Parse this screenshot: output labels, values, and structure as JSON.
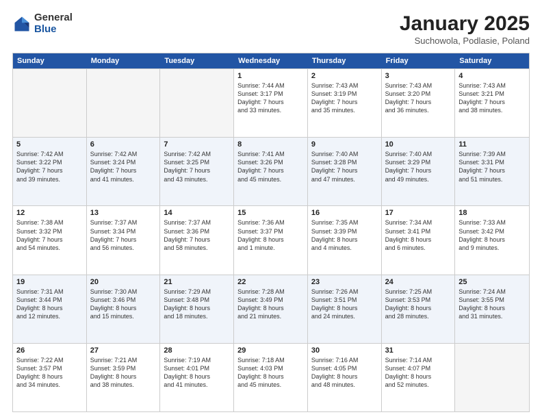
{
  "logo": {
    "general": "General",
    "blue": "Blue"
  },
  "title": "January 2025",
  "subtitle": "Suchowola, Podlasie, Poland",
  "header_days": [
    "Sunday",
    "Monday",
    "Tuesday",
    "Wednesday",
    "Thursday",
    "Friday",
    "Saturday"
  ],
  "rows": [
    [
      {
        "day": "",
        "info": "",
        "empty": true
      },
      {
        "day": "",
        "info": "",
        "empty": true
      },
      {
        "day": "",
        "info": "",
        "empty": true
      },
      {
        "day": "1",
        "info": "Sunrise: 7:44 AM\nSunset: 3:17 PM\nDaylight: 7 hours\nand 33 minutes."
      },
      {
        "day": "2",
        "info": "Sunrise: 7:43 AM\nSunset: 3:19 PM\nDaylight: 7 hours\nand 35 minutes."
      },
      {
        "day": "3",
        "info": "Sunrise: 7:43 AM\nSunset: 3:20 PM\nDaylight: 7 hours\nand 36 minutes."
      },
      {
        "day": "4",
        "info": "Sunrise: 7:43 AM\nSunset: 3:21 PM\nDaylight: 7 hours\nand 38 minutes."
      }
    ],
    [
      {
        "day": "5",
        "info": "Sunrise: 7:42 AM\nSunset: 3:22 PM\nDaylight: 7 hours\nand 39 minutes."
      },
      {
        "day": "6",
        "info": "Sunrise: 7:42 AM\nSunset: 3:24 PM\nDaylight: 7 hours\nand 41 minutes."
      },
      {
        "day": "7",
        "info": "Sunrise: 7:42 AM\nSunset: 3:25 PM\nDaylight: 7 hours\nand 43 minutes."
      },
      {
        "day": "8",
        "info": "Sunrise: 7:41 AM\nSunset: 3:26 PM\nDaylight: 7 hours\nand 45 minutes."
      },
      {
        "day": "9",
        "info": "Sunrise: 7:40 AM\nSunset: 3:28 PM\nDaylight: 7 hours\nand 47 minutes."
      },
      {
        "day": "10",
        "info": "Sunrise: 7:40 AM\nSunset: 3:29 PM\nDaylight: 7 hours\nand 49 minutes."
      },
      {
        "day": "11",
        "info": "Sunrise: 7:39 AM\nSunset: 3:31 PM\nDaylight: 7 hours\nand 51 minutes."
      }
    ],
    [
      {
        "day": "12",
        "info": "Sunrise: 7:38 AM\nSunset: 3:32 PM\nDaylight: 7 hours\nand 54 minutes."
      },
      {
        "day": "13",
        "info": "Sunrise: 7:37 AM\nSunset: 3:34 PM\nDaylight: 7 hours\nand 56 minutes."
      },
      {
        "day": "14",
        "info": "Sunrise: 7:37 AM\nSunset: 3:36 PM\nDaylight: 7 hours\nand 58 minutes."
      },
      {
        "day": "15",
        "info": "Sunrise: 7:36 AM\nSunset: 3:37 PM\nDaylight: 8 hours\nand 1 minute."
      },
      {
        "day": "16",
        "info": "Sunrise: 7:35 AM\nSunset: 3:39 PM\nDaylight: 8 hours\nand 4 minutes."
      },
      {
        "day": "17",
        "info": "Sunrise: 7:34 AM\nSunset: 3:41 PM\nDaylight: 8 hours\nand 6 minutes."
      },
      {
        "day": "18",
        "info": "Sunrise: 7:33 AM\nSunset: 3:42 PM\nDaylight: 8 hours\nand 9 minutes."
      }
    ],
    [
      {
        "day": "19",
        "info": "Sunrise: 7:31 AM\nSunset: 3:44 PM\nDaylight: 8 hours\nand 12 minutes."
      },
      {
        "day": "20",
        "info": "Sunrise: 7:30 AM\nSunset: 3:46 PM\nDaylight: 8 hours\nand 15 minutes."
      },
      {
        "day": "21",
        "info": "Sunrise: 7:29 AM\nSunset: 3:48 PM\nDaylight: 8 hours\nand 18 minutes."
      },
      {
        "day": "22",
        "info": "Sunrise: 7:28 AM\nSunset: 3:49 PM\nDaylight: 8 hours\nand 21 minutes."
      },
      {
        "day": "23",
        "info": "Sunrise: 7:26 AM\nSunset: 3:51 PM\nDaylight: 8 hours\nand 24 minutes."
      },
      {
        "day": "24",
        "info": "Sunrise: 7:25 AM\nSunset: 3:53 PM\nDaylight: 8 hours\nand 28 minutes."
      },
      {
        "day": "25",
        "info": "Sunrise: 7:24 AM\nSunset: 3:55 PM\nDaylight: 8 hours\nand 31 minutes."
      }
    ],
    [
      {
        "day": "26",
        "info": "Sunrise: 7:22 AM\nSunset: 3:57 PM\nDaylight: 8 hours\nand 34 minutes."
      },
      {
        "day": "27",
        "info": "Sunrise: 7:21 AM\nSunset: 3:59 PM\nDaylight: 8 hours\nand 38 minutes."
      },
      {
        "day": "28",
        "info": "Sunrise: 7:19 AM\nSunset: 4:01 PM\nDaylight: 8 hours\nand 41 minutes."
      },
      {
        "day": "29",
        "info": "Sunrise: 7:18 AM\nSunset: 4:03 PM\nDaylight: 8 hours\nand 45 minutes."
      },
      {
        "day": "30",
        "info": "Sunrise: 7:16 AM\nSunset: 4:05 PM\nDaylight: 8 hours\nand 48 minutes."
      },
      {
        "day": "31",
        "info": "Sunrise: 7:14 AM\nSunset: 4:07 PM\nDaylight: 8 hours\nand 52 minutes."
      },
      {
        "day": "",
        "info": "",
        "empty": true
      }
    ]
  ]
}
